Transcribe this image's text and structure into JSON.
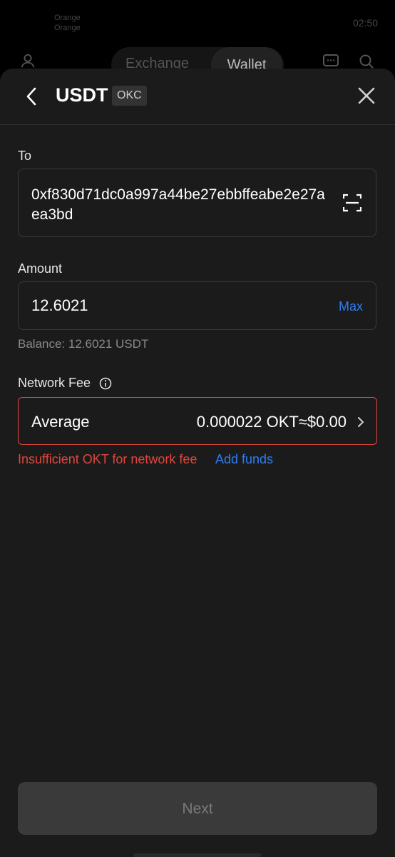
{
  "status_bar": {
    "carrier_line1": "Orange",
    "carrier_line2": "Orange",
    "time": "02:50"
  },
  "background_app": {
    "tabs": [
      "Exchange",
      "Wallet"
    ]
  },
  "header": {
    "title": "USDT",
    "chain_badge": "OKC"
  },
  "to": {
    "label": "To",
    "address": "0xf830d71dc0a997a44be27ebbffeabe2e27aea3bd"
  },
  "amount": {
    "label": "Amount",
    "value": "12.6021",
    "max_label": "Max",
    "balance_text": "Balance: 12.6021 USDT"
  },
  "network_fee": {
    "label": "Network Fee",
    "speed": "Average",
    "value": "0.000022 OKT≈$0.00",
    "error": "Insufficient OKT for network fee",
    "add_funds": "Add funds"
  },
  "footer": {
    "next_label": "Next"
  },
  "colors": {
    "accent_blue": "#2f7cf6",
    "error_red": "#e0463c",
    "sheet_bg": "#1b1b1b"
  },
  "icons": [
    "back-arrow-icon",
    "close-icon",
    "scan-icon",
    "info-icon",
    "chevron-right-icon",
    "user-icon",
    "chat-icon",
    "search-icon"
  ]
}
